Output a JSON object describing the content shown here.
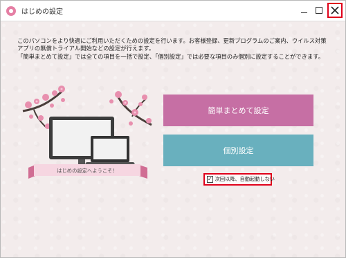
{
  "window": {
    "title": "はじめの設定",
    "controls": {
      "minimize": "minimize",
      "maximize": "maximize",
      "close": "close"
    }
  },
  "intro": {
    "lines": [
      "このパソコンをより快適にご利用いただくための設定を行います。お客様登録、更新プログラムのご案内、ウイルス対策",
      "アプリの無償トライアル開始などの設定が行えます。",
      "「簡単まとめて設定」では全ての項目を一括で設定、「個別設定」では必要な項目のみ個別に設定することができます。"
    ]
  },
  "illustration": {
    "banner": "はじめの設定へようこそ！"
  },
  "buttons": {
    "bulk": "簡単まとめて設定",
    "individual": "個別設定"
  },
  "startup_option": {
    "label": "次回以降、自動起動しない",
    "checked": true
  },
  "colors": {
    "bulk_button": "#c66fa4",
    "individual_button": "#69b0be",
    "highlight": "#e0001a",
    "blossom": "#e88fae"
  }
}
